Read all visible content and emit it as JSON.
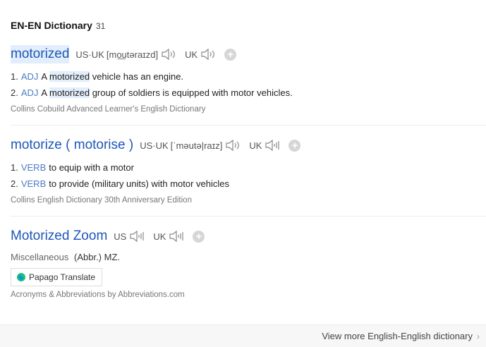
{
  "header": {
    "title": "EN-EN Dictionary",
    "count": "31"
  },
  "entries": [
    {
      "word": "motorized",
      "pron": [
        {
          "label": "US·UK",
          "ipa": "[mo͟utəraɪzd]"
        },
        {
          "label": "UK",
          "ipa": ""
        }
      ],
      "senses": [
        {
          "num": "1.",
          "pos": "ADJ",
          "pre": "A",
          "mark": "motorized",
          "post": "vehicle has an engine."
        },
        {
          "num": "2.",
          "pos": "ADJ",
          "pre": "A",
          "mark": "motorized",
          "post": "group of soldiers is equipped with motor vehicles."
        }
      ],
      "source": "Collins Cobuild Advanced Learner's English Dictionary"
    },
    {
      "word": "motorize ( motorise )",
      "pron": [
        {
          "label": "US·UK",
          "ipa": "[ˈməutə|raɪz]"
        },
        {
          "label": "UK",
          "ipa": ""
        }
      ],
      "senses": [
        {
          "num": "1.",
          "pos": "VERB",
          "text": "to equip with a motor"
        },
        {
          "num": "2.",
          "pos": "VERB",
          "text": "to provide (military units) with motor vehicles"
        }
      ],
      "source": "Collins English Dictionary 30th Anniversary Edition"
    },
    {
      "word": "Motorized Zoom",
      "pron": [
        {
          "label": "US",
          "ipa": ""
        },
        {
          "label": "UK",
          "ipa": ""
        }
      ],
      "category": "Miscellaneous",
      "abbr": "(Abbr.) MZ.",
      "translate_label": "Papago Translate",
      "source": "Acronyms & Abbreviations by Abbreviations.com"
    }
  ],
  "footer": {
    "more_label": "View more English-English dictionary"
  },
  "colors": {
    "word": "#1e57b8",
    "pos": "#4b7bc6",
    "highlight": "#e2eefb"
  },
  "icons": {
    "speaker": "speaker-icon",
    "add": "plus-icon",
    "more": "chevron-right-icon",
    "papago": "papago-logo-icon"
  }
}
